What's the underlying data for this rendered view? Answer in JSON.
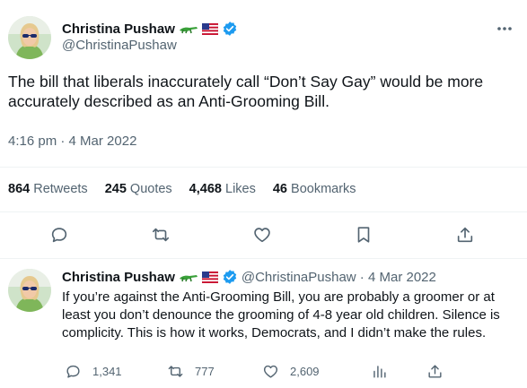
{
  "tweet": {
    "author": {
      "display_name": "Christina Pushaw",
      "handle": "@ChristinaPushaw",
      "badge_icons": [
        "alligator-emoji",
        "us-flag-emoji",
        "verified-badge-icon"
      ]
    },
    "text": "The bill that liberals inaccurately call “Don’t Say Gay” would be more accurately described as an Anti-Grooming Bill.",
    "timestamp": "4:16 pm · 4 Mar 2022",
    "stats": {
      "retweets": {
        "num": "864",
        "label": "Retweets"
      },
      "quotes": {
        "num": "245",
        "label": "Quotes"
      },
      "likes": {
        "num": "4,468",
        "label": "Likes"
      },
      "bookmarks": {
        "num": "46",
        "label": "Bookmarks"
      }
    },
    "actions": [
      "reply-icon",
      "retweet-icon",
      "like-icon",
      "bookmark-icon",
      "share-icon"
    ]
  },
  "reply": {
    "author": {
      "display_name": "Christina Pushaw",
      "handle_date": "@ChristinaPushaw · 4 Mar 2022"
    },
    "text": "If you’re against the Anti-Grooming Bill, you are probably a groomer or at least you don’t denounce the grooming of 4-8 year old children. Silence is complicity. This is how it works, Democrats, and I didn’t make the rules.",
    "counts": {
      "replies": "1,341",
      "retweets": "777",
      "likes": "2,609"
    }
  },
  "colors": {
    "text": "#0f1419",
    "secondary": "#536471",
    "verified": "#1d9bf0",
    "divider": "#eff3f4"
  }
}
